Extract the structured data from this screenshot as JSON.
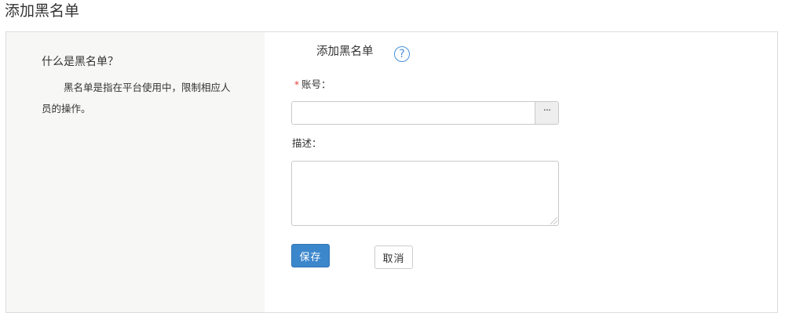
{
  "page": {
    "title": "添加黑名单"
  },
  "aside": {
    "heading": "什么是黑名单？",
    "body": "黑名单是指在平台使用中，限制相应人员的操作。"
  },
  "form": {
    "title": "添加黑名单",
    "help_icon": "?",
    "required_mark": "*",
    "account_label": "账号：",
    "account_value": "",
    "picker_label": "···",
    "description_label": "描述：",
    "description_value": "",
    "save_label": "保存",
    "cancel_label": "取消"
  },
  "colors": {
    "accent": "#3c86cc",
    "help_icon": "#4a90d9",
    "required": "#e33b3b",
    "aside_bg": "#f7f7f5"
  },
  "icons": {
    "help": "question-circle-icon",
    "picker": "ellipsis-icon",
    "grip": "resize-grip-icon"
  }
}
